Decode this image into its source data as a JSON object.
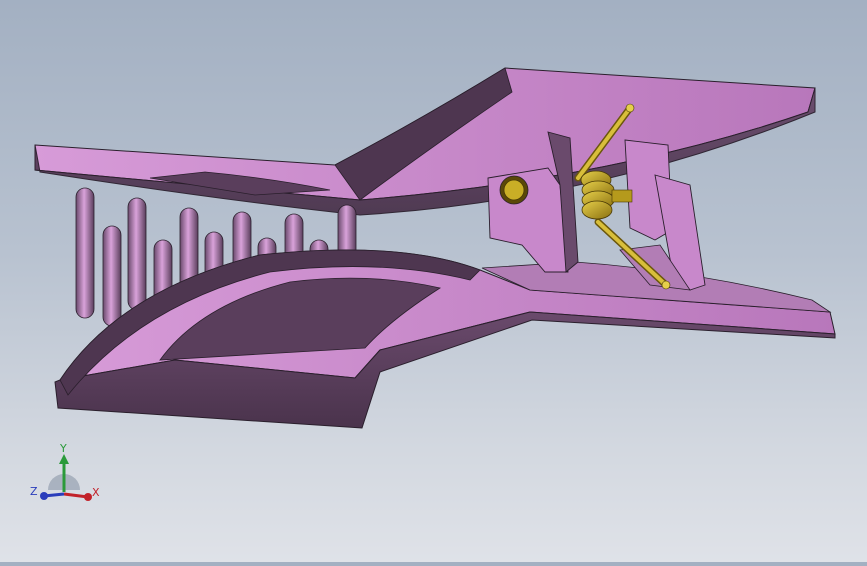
{
  "viewport": {
    "model": "clip-assembly",
    "colors": {
      "background_top": "#a3b0c2",
      "background_bottom": "#dfe2e8",
      "part_face_top": "#c688c9",
      "part_face_dark": "#5a3e5c",
      "part_edge": "#2a1f2c",
      "spring_gold": "#b59a1c"
    }
  },
  "triad": {
    "x_label": "X",
    "y_label": "Y",
    "z_label": "Z",
    "colors": {
      "x": "#c2222a",
      "y": "#2a9a3a",
      "z": "#2a3dbb"
    }
  }
}
